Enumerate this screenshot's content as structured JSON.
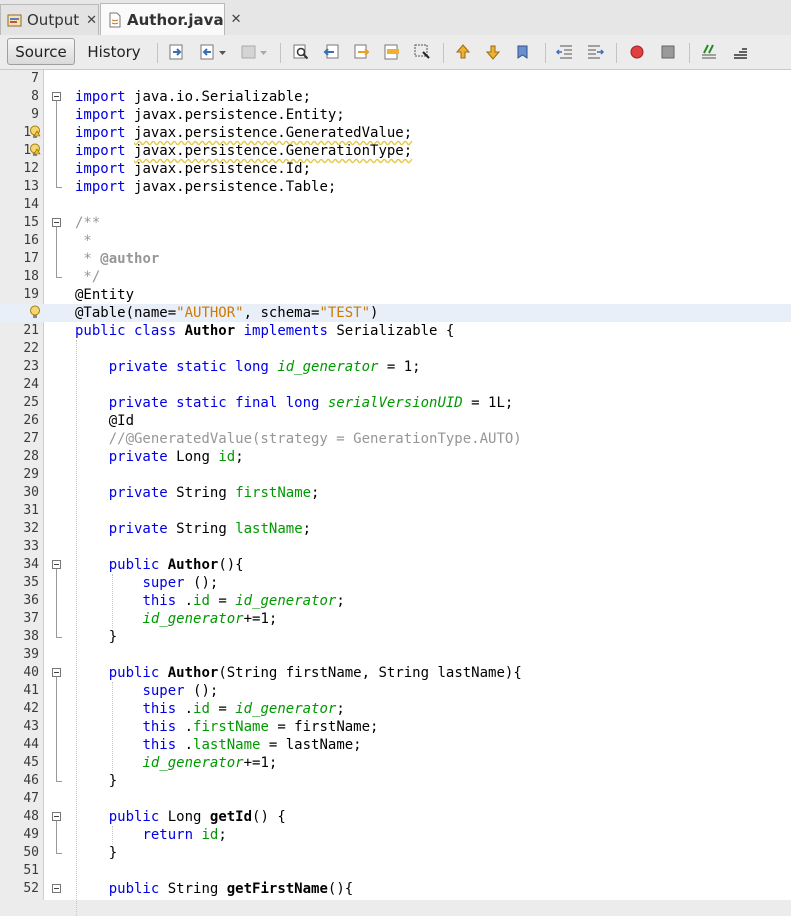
{
  "tabs": [
    {
      "label": "Output",
      "active": false
    },
    {
      "label": "Author.java",
      "active": true
    }
  ],
  "toolbar": {
    "source_label": "Source",
    "history_label": "History",
    "icons": [
      "last-edit-icon",
      "back-icon",
      "forward-icon",
      "find-icon",
      "find-previous-icon",
      "find-next-icon",
      "toggle-highlight-icon",
      "toggle-rectangular-selection-icon",
      "previous-bookmark-icon",
      "next-bookmark-icon",
      "toggle-bookmark-icon",
      "shift-left-icon",
      "shift-right-icon",
      "start-macro-icon",
      "stop-macro-icon",
      "comment-icon",
      "uncomment-icon"
    ]
  },
  "editor": {
    "highlighted_line": 20,
    "lines": [
      {
        "n": "7",
        "t": []
      },
      {
        "n": "8",
        "t": [
          [
            "kw",
            "import"
          ],
          [
            "",
            "java.io.Serializable;"
          ]
        ]
      },
      {
        "n": "9",
        "t": [
          [
            "kw",
            "import"
          ],
          [
            "",
            "javax.persistence.Entity;"
          ]
        ]
      },
      {
        "n": "10",
        "t": [
          [
            "kw",
            "import"
          ],
          [
            "w",
            "javax.persistence.GeneratedValue;"
          ]
        ],
        "warn": true
      },
      {
        "n": "11",
        "t": [
          [
            "kw",
            "import"
          ],
          [
            "w",
            "javax.persistence.GenerationType;"
          ]
        ],
        "warn": true
      },
      {
        "n": "12",
        "t": [
          [
            "kw",
            "import"
          ],
          [
            "",
            "javax.persistence.Id;"
          ]
        ]
      },
      {
        "n": "13",
        "t": [
          [
            "kw",
            "import"
          ],
          [
            "",
            "javax.persistence.Table;"
          ]
        ]
      },
      {
        "n": "14",
        "t": []
      },
      {
        "n": "15",
        "t": [
          [
            "cmt",
            "/**"
          ]
        ]
      },
      {
        "n": "16",
        "t": [
          [
            "cmt",
            " *"
          ]
        ]
      },
      {
        "n": "17",
        "t": [
          [
            "cmt",
            " * "
          ],
          [
            "jd",
            "@author"
          ]
        ]
      },
      {
        "n": "18",
        "t": [
          [
            "cmt",
            " */"
          ]
        ]
      },
      {
        "n": "19",
        "t": [
          [
            "",
            "@Entity"
          ]
        ]
      },
      {
        "n": "",
        "t": [
          [
            "",
            "@Table(name="
          ],
          [
            "str",
            "\"AUTHOR\""
          ],
          [
            "",
            ", schema="
          ],
          [
            "str",
            "\"TEST\""
          ],
          [
            "",
            ")"
          ]
        ],
        "bulb": true
      },
      {
        "n": "21",
        "t": [
          [
            "kw",
            "public class"
          ],
          [
            "b",
            "Author"
          ],
          [
            "kw",
            "implements"
          ],
          [
            "",
            "Serializable {"
          ]
        ]
      },
      {
        "n": "22",
        "t": []
      },
      {
        "n": "23",
        "t": [
          [
            "",
            "    "
          ],
          [
            "kw",
            "private static long"
          ],
          [
            "sfld",
            "id_generator"
          ],
          [
            "",
            " = 1;"
          ]
        ]
      },
      {
        "n": "24",
        "t": []
      },
      {
        "n": "25",
        "t": [
          [
            "",
            "    "
          ],
          [
            "kw",
            "private static final long"
          ],
          [
            "sfld",
            "serialVersionUID"
          ],
          [
            "",
            " = 1L;"
          ]
        ]
      },
      {
        "n": "26",
        "t": [
          [
            "",
            "    @Id"
          ]
        ]
      },
      {
        "n": "27",
        "t": [
          [
            "",
            "    "
          ],
          [
            "cmt",
            "//@GeneratedValue(strategy = GenerationType.AUTO)"
          ]
        ]
      },
      {
        "n": "28",
        "t": [
          [
            "",
            "    "
          ],
          [
            "kw",
            "private"
          ],
          [
            "",
            "Long "
          ],
          [
            "fld",
            "id"
          ],
          [
            "",
            ";"
          ]
        ]
      },
      {
        "n": "29",
        "t": []
      },
      {
        "n": "30",
        "t": [
          [
            "",
            "    "
          ],
          [
            "kw",
            "private"
          ],
          [
            "",
            "String "
          ],
          [
            "fld",
            "firstName"
          ],
          [
            "",
            ";"
          ]
        ]
      },
      {
        "n": "31",
        "t": []
      },
      {
        "n": "32",
        "t": [
          [
            "",
            "    "
          ],
          [
            "kw",
            "private"
          ],
          [
            "",
            "String "
          ],
          [
            "fld",
            "lastName"
          ],
          [
            "",
            ";"
          ]
        ]
      },
      {
        "n": "33",
        "t": []
      },
      {
        "n": "34",
        "t": [
          [
            "",
            "    "
          ],
          [
            "kw",
            "public"
          ],
          [
            "b",
            "Author"
          ],
          [
            "",
            "(){"
          ]
        ]
      },
      {
        "n": "35",
        "t": [
          [
            "",
            "        "
          ],
          [
            "kw",
            "super"
          ],
          [
            "",
            "();"
          ]
        ]
      },
      {
        "n": "36",
        "t": [
          [
            "",
            "        "
          ],
          [
            "kw",
            "this"
          ],
          [
            "",
            "."
          ],
          [
            "fld",
            "id"
          ],
          [
            "",
            " = "
          ],
          [
            "sfld",
            "id_generator"
          ],
          [
            "",
            ";"
          ]
        ]
      },
      {
        "n": "37",
        "t": [
          [
            "",
            "        "
          ],
          [
            "sfld",
            "id_generator"
          ],
          [
            "",
            "+=1;"
          ]
        ]
      },
      {
        "n": "38",
        "t": [
          [
            "",
            "    }"
          ]
        ]
      },
      {
        "n": "39",
        "t": []
      },
      {
        "n": "40",
        "t": [
          [
            "",
            "    "
          ],
          [
            "kw",
            "public"
          ],
          [
            "b",
            "Author"
          ],
          [
            "",
            "(String firstName, String lastName){"
          ]
        ]
      },
      {
        "n": "41",
        "t": [
          [
            "",
            "        "
          ],
          [
            "kw",
            "super"
          ],
          [
            "",
            "();"
          ]
        ]
      },
      {
        "n": "42",
        "t": [
          [
            "",
            "        "
          ],
          [
            "kw",
            "this"
          ],
          [
            "",
            "."
          ],
          [
            "fld",
            "id"
          ],
          [
            "",
            " = "
          ],
          [
            "sfld",
            "id_generator"
          ],
          [
            "",
            ";"
          ]
        ]
      },
      {
        "n": "43",
        "t": [
          [
            "",
            "        "
          ],
          [
            "kw",
            "this"
          ],
          [
            "",
            "."
          ],
          [
            "fld",
            "firstName"
          ],
          [
            "",
            " = firstName;"
          ]
        ]
      },
      {
        "n": "44",
        "t": [
          [
            "",
            "        "
          ],
          [
            "kw",
            "this"
          ],
          [
            "",
            "."
          ],
          [
            "fld",
            "lastName"
          ],
          [
            "",
            " = lastName;"
          ]
        ]
      },
      {
        "n": "45",
        "t": [
          [
            "",
            "        "
          ],
          [
            "sfld",
            "id_generator"
          ],
          [
            "",
            "+=1;"
          ]
        ]
      },
      {
        "n": "46",
        "t": [
          [
            "",
            "    }"
          ]
        ]
      },
      {
        "n": "47",
        "t": []
      },
      {
        "n": "48",
        "t": [
          [
            "",
            "    "
          ],
          [
            "kw",
            "public"
          ],
          [
            "",
            "Long "
          ],
          [
            "b",
            "getId"
          ],
          [
            "",
            "() {"
          ]
        ]
      },
      {
        "n": "49",
        "t": [
          [
            "",
            "        "
          ],
          [
            "kw",
            "return"
          ],
          [
            "fld",
            "id"
          ],
          [
            "",
            ";"
          ]
        ]
      },
      {
        "n": "50",
        "t": [
          [
            "",
            "    }"
          ]
        ]
      },
      {
        "n": "51",
        "t": []
      },
      {
        "n": "52",
        "t": [
          [
            "",
            "    "
          ],
          [
            "kw",
            "public"
          ],
          [
            "",
            "String "
          ],
          [
            "b",
            "getFirstName"
          ],
          [
            "",
            "(){"
          ]
        ]
      }
    ]
  }
}
